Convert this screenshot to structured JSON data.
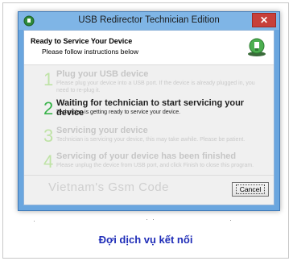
{
  "window": {
    "title": "USB Redirector Technician Edition",
    "close_label": "✕"
  },
  "header": {
    "title": "Ready to Service Your Device",
    "subtitle": "Please follow instructions below"
  },
  "steps": [
    {
      "number": "1",
      "title": "Plug your USB device",
      "desc": "Please plug your device into a USB port. If the device is already plugged in, you need to re-plug it."
    },
    {
      "number": "2",
      "title": "Waiting for technician to start servicing your device",
      "desc": "Technician is getting ready to service your device."
    },
    {
      "number": "3",
      "title": "Servicing your device",
      "desc": "Technician is servicing your device, this may take awhile. Please be patient."
    },
    {
      "number": "4",
      "title": "Servicing of your device has been finished",
      "desc": "Please unplug the device from USB port, and click Finish to close this program."
    }
  ],
  "footer": {
    "watermark": "Vietnam's Gsm Code",
    "cancel_label": "Cancel"
  },
  "caption": "Đợi dịch vụ kết nối",
  "colors": {
    "active_number": "#39b34a",
    "caption": "#1f2db8",
    "titlebar": "#7fb5e6",
    "close": "#c7403a"
  }
}
